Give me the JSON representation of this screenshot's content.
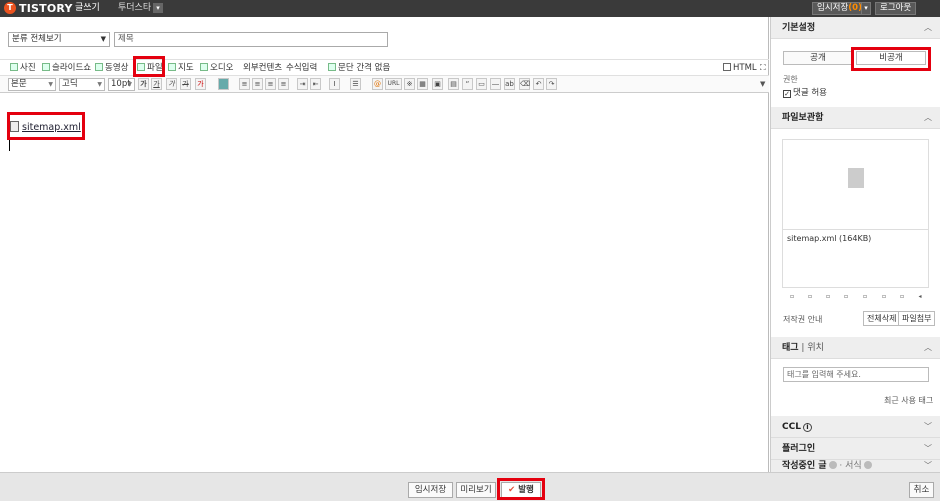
{
  "topbar": {
    "logo_mark": "T",
    "brand": "TISTORY",
    "brand_sub": "글쓰기",
    "blog_name": "투더스타",
    "blog_dropdown_icon": "chevron-down-icon",
    "temp_save_label": "임시저장",
    "temp_save_count": "(0)",
    "logout_label": "로그아웃"
  },
  "editor": {
    "category": "분류 전체보기",
    "title_placeholder": "제목",
    "toolbar1": {
      "photo": "사진",
      "slideshow": "슬라이드쇼",
      "video": "동영상",
      "file": "파일",
      "map": "지도",
      "audio": "오디오",
      "external": "외부컨텐츠",
      "formula": "수식입력",
      "paragraph_spacing": "문단 간격 없음",
      "html_label": "HTML"
    },
    "toolbar2": {
      "paragraph_style": "본문",
      "font": "고딕",
      "font_size": "10pt",
      "bold": "가",
      "underline": "가",
      "italic": "가",
      "strike": "가",
      "text_color": "가",
      "url": "URL"
    },
    "body": {
      "attachment": "sitemap.xml"
    }
  },
  "sidebar": {
    "basic_settings": "기본설정",
    "public_label": "공개",
    "private_label": "비공개",
    "permission_label": "권한",
    "comment_allow": "댓글 허용",
    "file_storage": "파일보관함",
    "file_list": [
      "sitemap.xml (164KB)"
    ],
    "copyright_label": "저작권 안내",
    "delete_all_label": "전체삭제",
    "file_upload_label": "파일첨부",
    "tag_label": "태그",
    "location_label": "위치",
    "tag_placeholder": "태그를 입력해 주세요.",
    "recent_tags": "최근 사용 태그",
    "ccl_label": "CCL",
    "plugin_label": "플러그인",
    "writing_label": "작성중인 글",
    "format_label": "서식"
  },
  "footer": {
    "temp_save": "임시저장",
    "preview": "미리보기",
    "publish": "발행",
    "cancel": "취소"
  },
  "colors": {
    "topbar": "#3a3a3a",
    "brand_orange": "#eb531f",
    "highlight": "#e4000f"
  }
}
